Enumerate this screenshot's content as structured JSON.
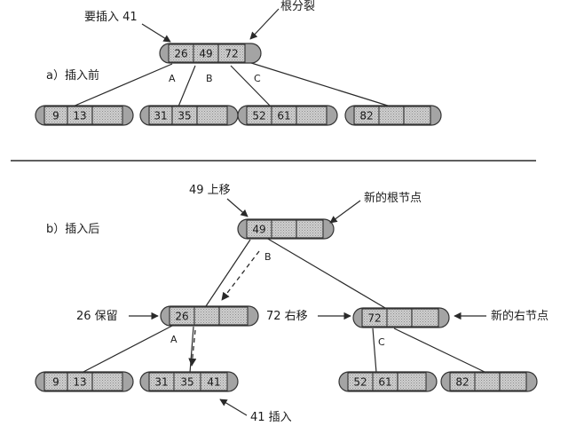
{
  "top": {
    "label": "a）插入前",
    "insert_note": "要插入 41",
    "split_note": "根分裂",
    "root_keys": [
      "26",
      "49",
      "72"
    ],
    "branch_labels": [
      "A",
      "B",
      "C"
    ],
    "leaves": [
      [
        "9",
        "13",
        ""
      ],
      [
        "31",
        "35",
        ""
      ],
      [
        "52",
        "61",
        ""
      ],
      [
        "82",
        "",
        ""
      ]
    ]
  },
  "bottom": {
    "label": "b）插入后",
    "root_keys": [
      "49",
      "",
      ""
    ],
    "root_note": "49 上移",
    "new_root_note": "新的根节点",
    "left_keys": [
      "26",
      "",
      ""
    ],
    "left_note": "26 保留",
    "right_keys": [
      "72",
      "",
      ""
    ],
    "right_note": "72 右移",
    "new_right_note": "新的右节点",
    "branch_b": "B",
    "branch_a": "A",
    "branch_c": "C",
    "leaves": [
      [
        "9",
        "13",
        ""
      ],
      [
        "31",
        "35",
        "41"
      ],
      [
        "52",
        "61",
        ""
      ],
      [
        "82",
        "",
        ""
      ]
    ],
    "insert_done_note": "41 插入"
  }
}
